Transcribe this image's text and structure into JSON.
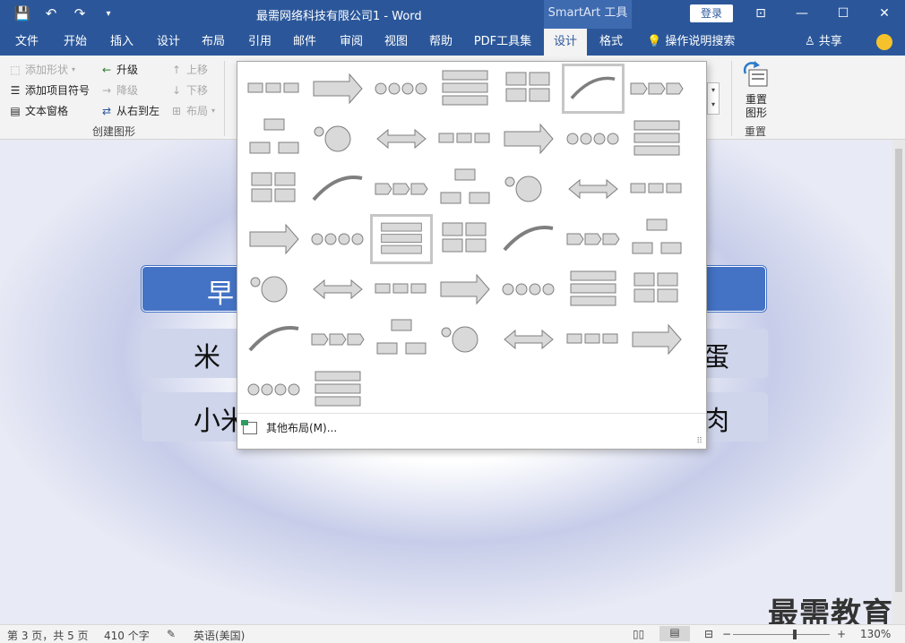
{
  "titlebar": {
    "title": "最需网络科技有限公司1 - Word",
    "contextual_tab": "SmartArt 工具",
    "login": "登录",
    "quick_access": {
      "save": "💾",
      "undo": "↶",
      "redo": "↷",
      "customize": "▾"
    },
    "window": {
      "restore_ribbon": "⊡",
      "minimize": "—",
      "maximize": "☐",
      "close": "✕"
    }
  },
  "tabs": [
    {
      "label": "文件"
    },
    {
      "label": "开始"
    },
    {
      "label": "插入"
    },
    {
      "label": "设计"
    },
    {
      "label": "布局"
    },
    {
      "label": "引用"
    },
    {
      "label": "邮件"
    },
    {
      "label": "审阅"
    },
    {
      "label": "视图"
    },
    {
      "label": "帮助"
    },
    {
      "label": "PDF工具集"
    },
    {
      "label": "设计"
    },
    {
      "label": "格式"
    }
  ],
  "tellme": "操作说明搜索",
  "share": "共享",
  "ribbon": {
    "create_graphic": {
      "add_shape": "添加形状",
      "add_bullet": "添加项目符号",
      "text_pane": "文本窗格",
      "promote": "升级",
      "demote": "降级",
      "rtl": "从右到左",
      "move_up": "上移",
      "move_down": "下移",
      "layout": "布局",
      "label": "创建图形"
    },
    "reset": {
      "button_line1": "重置",
      "button_line2": "图形",
      "label": "重置"
    }
  },
  "document": {
    "header_text": "早",
    "row1_left": "米",
    "row1_right": "蛋",
    "row2_left": "小米",
    "row2_right": "肉"
  },
  "gallery": {
    "more_layouts": "其他布局(M)..."
  },
  "statusbar": {
    "page": "第 3 页，共 5 页",
    "words": "410 个字",
    "language": "英语(美国)",
    "zoom": "130%",
    "zoom_minus": "−",
    "zoom_plus": "+"
  },
  "watermark": "最需教育",
  "colors": {
    "brand": "#2b579a",
    "smartart_blue": "#4472c4",
    "smartart_light": "#cfd5eb"
  }
}
